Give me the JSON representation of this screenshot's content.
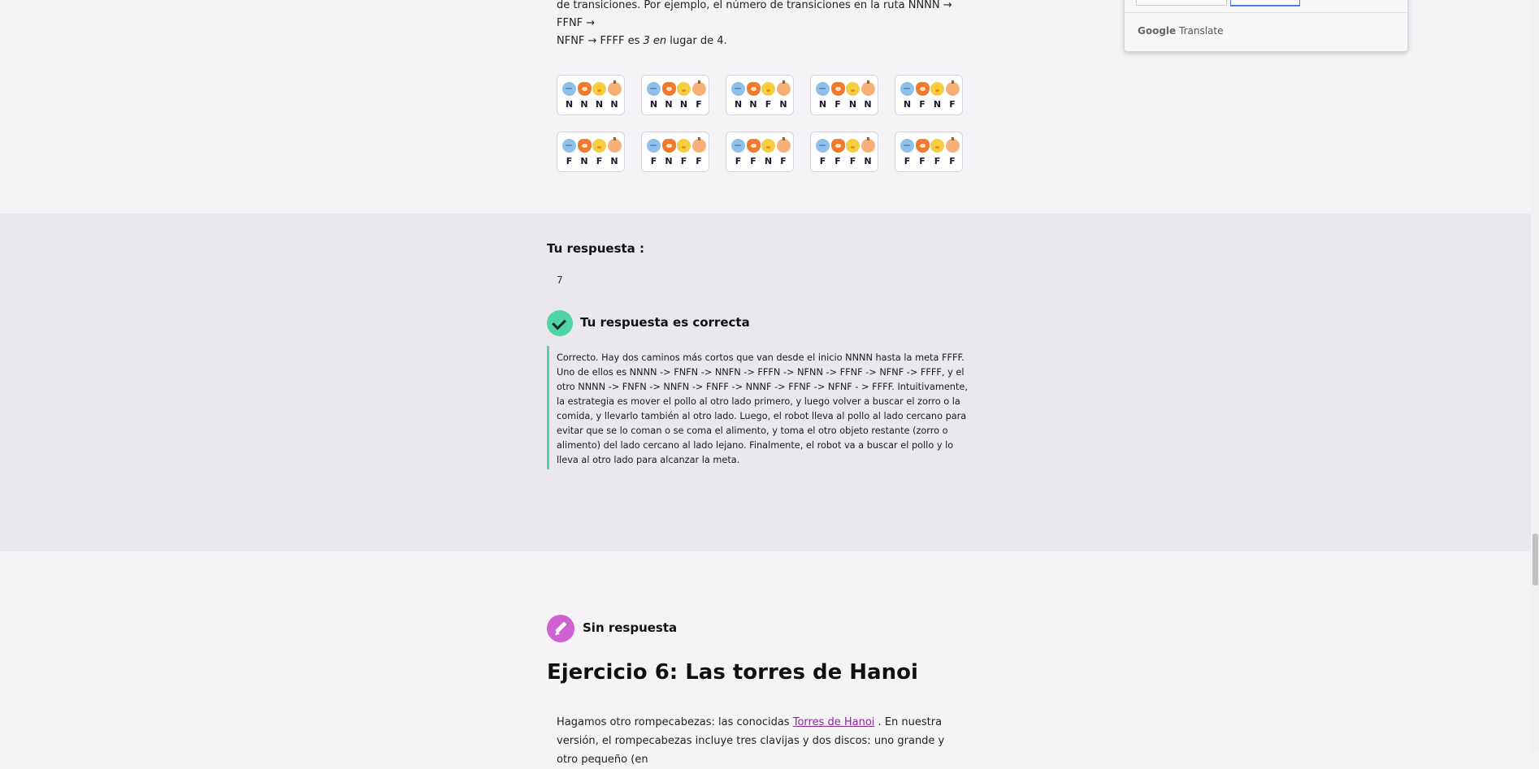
{
  "intro": {
    "line1": "de transiciones. Por ejemplo, el número de transiciones en la ruta NNNN → FFNF →",
    "line2_pre": "NFNF → FFFF es ",
    "line2_ital": "3 en",
    "line2_post": " lugar de 4."
  },
  "state_cards": [
    {
      "letters": [
        "N",
        "N",
        "N",
        "N"
      ]
    },
    {
      "letters": [
        "N",
        "N",
        "N",
        "F"
      ]
    },
    {
      "letters": [
        "N",
        "N",
        "F",
        "N"
      ]
    },
    {
      "letters": [
        "N",
        "F",
        "N",
        "N"
      ]
    },
    {
      "letters": [
        "N",
        "F",
        "N",
        "F"
      ]
    },
    {
      "letters": [
        "F",
        "N",
        "F",
        "N"
      ]
    },
    {
      "letters": [
        "F",
        "N",
        "F",
        "F"
      ]
    },
    {
      "letters": [
        "F",
        "F",
        "N",
        "F"
      ]
    },
    {
      "letters": [
        "F",
        "F",
        "F",
        "N"
      ]
    },
    {
      "letters": [
        "F",
        "F",
        "F",
        "F"
      ]
    }
  ],
  "state_icons": [
    "fish-icon",
    "fox-icon",
    "chick-icon",
    "food-icon"
  ],
  "answer": {
    "heading": "Tu respuesta :",
    "value": "7",
    "status_label": "Tu respuesta es correcta",
    "explanation": "Correcto. Hay dos caminos más cortos que van desde el inicio NNNN hasta la meta FFFF. Uno de ellos es NNNN -> FNFN -> NNFN -> FFFN -> NFNN -> FFNF -> NFNF -> FFFF, y el otro NNNN -> FNFN -> NNFN -> FNFF -> NNNF -> FFNF -> NFNF - > FFFF. Intuitivamente, la estrategia es mover el pollo al otro lado primero, y luego volver a buscar el zorro o la comida, y llevarlo también al otro lado. Luego, el robot lleva al pollo al lado cercano para evitar que se lo coman o se coma el alimento, y toma el otro objeto restante (zorro o alimento) del lado cercano al lado lejano. Finalmente, el robot va a buscar el pollo y lo lleva al otro lado para alcanzar la meta."
  },
  "next": {
    "status_label": "Sin respuesta",
    "title": "Ejercicio 6: Las torres de Hanoi",
    "text_pre": "Hagamos otro rompecabezas: las conocidas ",
    "link_text": "Torres de Hanoi",
    "text_post": " . En nuestra versión, el rompecabezas incluye tres clavijas y dos discos: uno grande y otro pequeño (en"
  },
  "translate_popup": {
    "brand_google": "Google",
    "brand_translate": "Translate"
  },
  "colors": {
    "accent_green": "#4fd3a7",
    "pencil_purple": "#cf62d3",
    "link": "#8a2d96"
  }
}
